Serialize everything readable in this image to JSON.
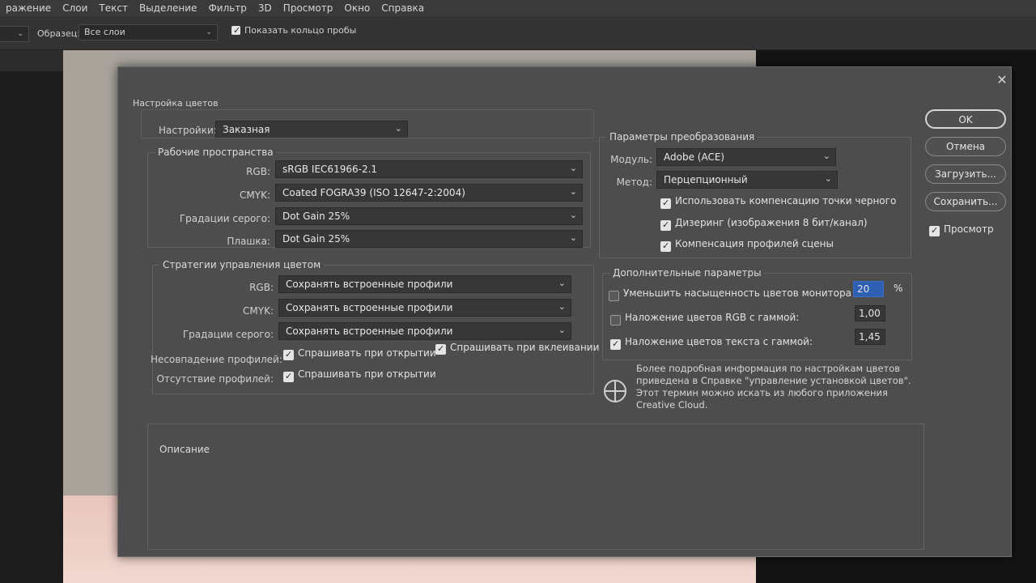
{
  "menubar": {
    "items": [
      "ражение",
      "Слои",
      "Текст",
      "Выделение",
      "Фильтр",
      "3D",
      "Просмотр",
      "Окно",
      "Справка"
    ]
  },
  "optionsbar": {
    "sample_label": "Образец:",
    "sample_value": "Все слои",
    "show_ring_label": "Показать кольцо пробы",
    "show_ring_checked": true
  },
  "dialog": {
    "title": "Настройка цветов",
    "close_glyph": "✕",
    "settings_label": "Настройки:",
    "settings_value": "Заказная",
    "working_spaces": {
      "title": "Рабочие пространства",
      "rows": [
        {
          "label": "RGB:",
          "value": "sRGB IEC61966-2.1"
        },
        {
          "label": "CMYK:",
          "value": "Coated FOGRA39 (ISO 12647-2:2004)"
        },
        {
          "label": "Градации серого:",
          "value": "Dot Gain 25%"
        },
        {
          "label": "Плашка:",
          "value": "Dot Gain 25%"
        }
      ]
    },
    "policies": {
      "title": "Стратегии управления цветом",
      "rows": [
        {
          "label": "RGB:",
          "value": "Сохранять встроенные профили"
        },
        {
          "label": "CMYK:",
          "value": "Сохранять встроенные профили"
        },
        {
          "label": "Градации серого:",
          "value": "Сохранять встроенные профили"
        }
      ],
      "mismatch_label": "Несовпадение профилей:",
      "mismatch_open": {
        "label": "Спрашивать при открытии",
        "checked": true
      },
      "mismatch_paste": {
        "label": "Спрашивать при вклеивании",
        "checked": true
      },
      "missing_label": "Отсутствие профилей:",
      "missing_open": {
        "label": "Спрашивать при открытии",
        "checked": true
      }
    },
    "conversion": {
      "title": "Параметры преобразования",
      "engine_label": "Модуль:",
      "engine_value": "Adobe (ACE)",
      "intent_label": "Метод:",
      "intent_value": "Перцепционный",
      "checks": [
        {
          "label": "Использовать компенсацию точки черного",
          "checked": true
        },
        {
          "label": "Дизеринг (изображения 8 бит/канал)",
          "checked": true
        },
        {
          "label": "Компенсация профилей сцены",
          "checked": true
        }
      ]
    },
    "advanced": {
      "title": "Дополнительные параметры",
      "desaturate": {
        "label": "Уменьшить насыщенность цветов монитора на:",
        "checked": false,
        "value": "20",
        "unit": "%"
      },
      "blend_rgb": {
        "label": "Наложение цветов RGB с гаммой:",
        "checked": false,
        "value": "1,00"
      },
      "blend_text": {
        "label": "Наложение цветов текста с гаммой:",
        "checked": true,
        "value": "1,45"
      }
    },
    "info": "Более подробная информация по настройкам цветов приведена в Справке \"управление установкой цветов\". Этот термин можно искать из любого приложения Creative Cloud.",
    "description_title": "Описание",
    "buttons": {
      "ok": "OK",
      "cancel": "Отмена",
      "load": "Загрузить...",
      "save": "Сохранить..."
    },
    "preview": {
      "label": "Просмотр",
      "checked": true
    }
  }
}
